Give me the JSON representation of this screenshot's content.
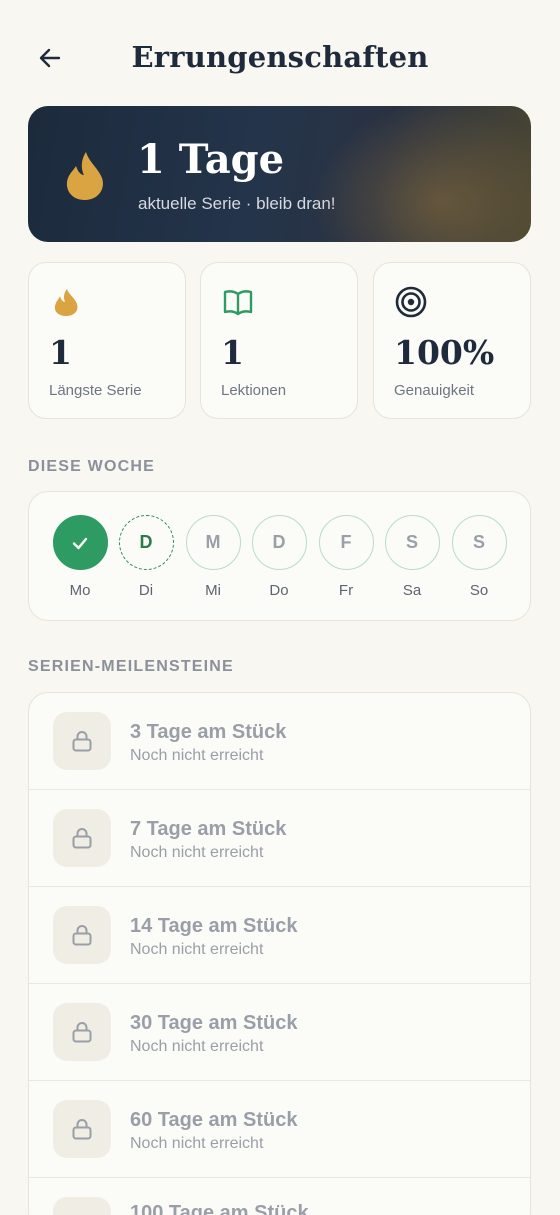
{
  "header": {
    "title": "Errungenschaften"
  },
  "streak": {
    "value": "1 Tage",
    "subtitle": "aktuelle Serie · bleib dran!"
  },
  "stats": [
    {
      "value": "1",
      "label": "Längste Serie",
      "icon": "flame-icon",
      "color": "#d9a441"
    },
    {
      "value": "1",
      "label": "Lektionen",
      "icon": "book-icon",
      "color": "#2e9c62"
    },
    {
      "value": "100%",
      "label": "Genauigkeit",
      "icon": "target-icon",
      "color": "#1f2a3a"
    }
  ],
  "week": {
    "label": "DIESE WOCHE",
    "days": [
      {
        "letter": "",
        "name": "Mo",
        "state": "done"
      },
      {
        "letter": "D",
        "name": "Di",
        "state": "today"
      },
      {
        "letter": "M",
        "name": "Mi",
        "state": "upcoming"
      },
      {
        "letter": "D",
        "name": "Do",
        "state": "upcoming"
      },
      {
        "letter": "F",
        "name": "Fr",
        "state": "upcoming"
      },
      {
        "letter": "S",
        "name": "Sa",
        "state": "upcoming"
      },
      {
        "letter": "S",
        "name": "So",
        "state": "upcoming"
      }
    ]
  },
  "milestones": {
    "label": "SERIEN-MEILENSTEINE",
    "items": [
      {
        "title": "3 Tage am Stück",
        "status": "Noch nicht erreicht"
      },
      {
        "title": "7 Tage am Stück",
        "status": "Noch nicht erreicht"
      },
      {
        "title": "14 Tage am Stück",
        "status": "Noch nicht erreicht"
      },
      {
        "title": "30 Tage am Stück",
        "status": "Noch nicht erreicht"
      },
      {
        "title": "60 Tage am Stück",
        "status": "Noch nicht erreicht"
      },
      {
        "title": "100 Tage am Stück",
        "status": ""
      }
    ]
  },
  "colors": {
    "background": "#f8f7f2",
    "primary_text": "#1f2a3a",
    "success_green": "#2e9c62",
    "flame_gold": "#d9a441"
  }
}
